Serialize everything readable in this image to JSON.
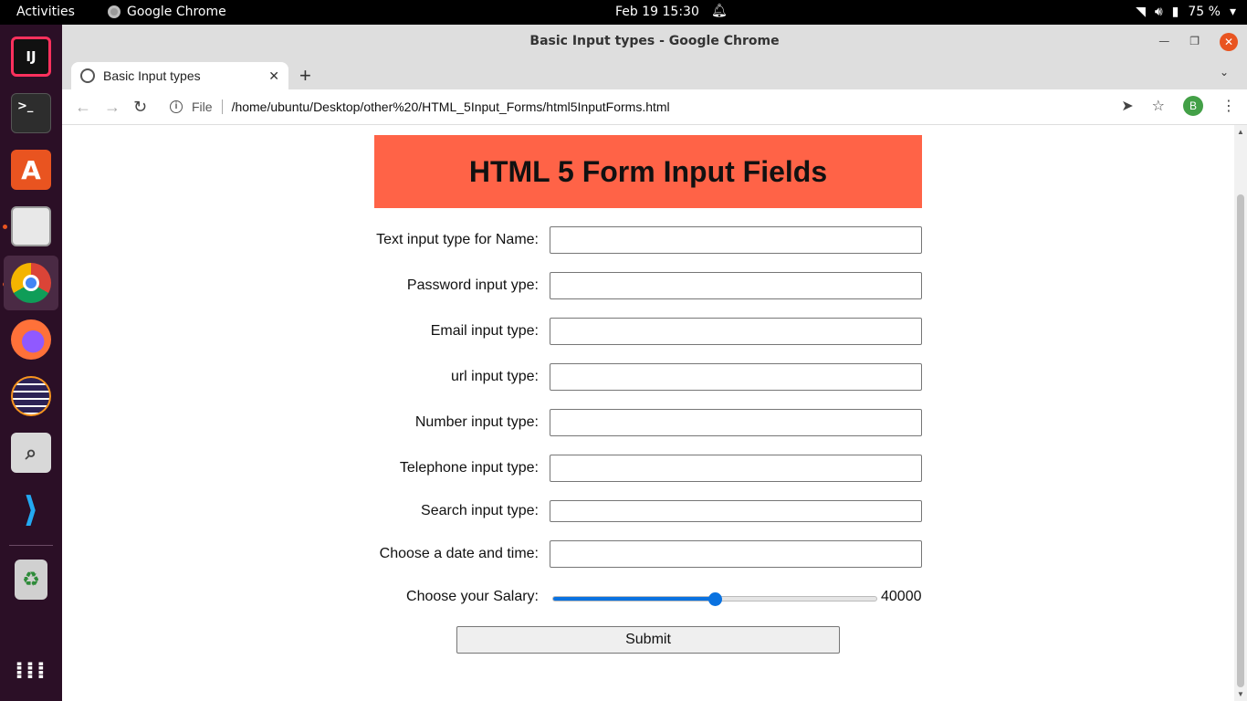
{
  "topbar": {
    "activities": "Activities",
    "app_name": "Google Chrome",
    "clock": "Feb 19  15:30",
    "battery": "75 %"
  },
  "dock": {
    "items": [
      {
        "name": "intellij",
        "label": "IJ",
        "color": "#1a1a1a",
        "accent": "#fe315d"
      },
      {
        "name": "terminal",
        "label": ">_",
        "color": "#2d2d2d"
      },
      {
        "name": "software",
        "label": "A",
        "color": "#e95420"
      },
      {
        "name": "files",
        "label": "",
        "color": "#d9d9d9"
      },
      {
        "name": "chrome",
        "label": "",
        "color": "#ffffff"
      },
      {
        "name": "firefox",
        "label": "",
        "color": "#ff7139"
      },
      {
        "name": "eclipse",
        "label": "",
        "color": "#2c2255"
      },
      {
        "name": "image-viewer",
        "label": "",
        "color": "#cfcfcf"
      },
      {
        "name": "vscode",
        "label": "",
        "color": "#0065a9"
      },
      {
        "name": "trash",
        "label": "♻",
        "color": "#cfcfcf"
      }
    ]
  },
  "window": {
    "title": "Basic Input types - Google Chrome"
  },
  "tab": {
    "label": "Basic Input types"
  },
  "omnibox": {
    "scheme_label": "File",
    "url": "/home/ubuntu/Desktop/other%20/HTML_5Input_Forms/html5InputForms.html",
    "avatar": "B"
  },
  "page": {
    "heading": "HTML 5 Form Input Fields",
    "fields": {
      "name_label": "Text input type for Name:",
      "password_label": "Password input ype:",
      "email_label": "Email input type:",
      "url_label": "url input type:",
      "number_label": "Number input type:",
      "telephone_label": "Telephone input type:",
      "search_label": "Search input type:",
      "datetime_label": "Choose a date and time:",
      "salary_label": "Choose your Salary:"
    },
    "salary": {
      "value": "40000",
      "fraction": 0.5
    },
    "submit": "Submit",
    "accent": "#ff6347"
  }
}
